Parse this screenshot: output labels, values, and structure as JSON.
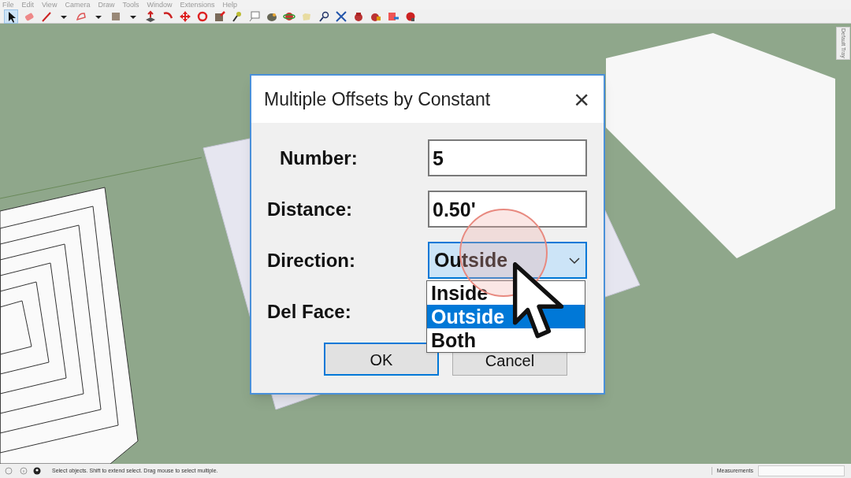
{
  "menu": [
    "File",
    "Edit",
    "View",
    "Camera",
    "Draw",
    "Tools",
    "Window",
    "Extensions",
    "Help"
  ],
  "tray_tab": "Default Tray",
  "dialog": {
    "title": "Multiple Offsets by Constant",
    "close": "×",
    "fields": [
      {
        "label": "Number:",
        "kind": "text",
        "value": "5"
      },
      {
        "label": "Distance:",
        "kind": "text",
        "value": "0.50'"
      },
      {
        "label": "Direction:",
        "kind": "dropdown",
        "value": "Outside",
        "expanded": true,
        "options": [
          {
            "label": "Inside",
            "selected": false
          },
          {
            "label": "Outside",
            "selected": true
          },
          {
            "label": "Both",
            "selected": false
          }
        ]
      },
      {
        "label": "Del Face:",
        "kind": "covered"
      }
    ],
    "buttons": [
      {
        "label": "OK",
        "focused": true
      },
      {
        "label": "Cancel",
        "focused": false
      }
    ]
  },
  "status_bar": {
    "message": "Select objects. Shift to extend select. Drag mouse to select multiple.",
    "measurements_label": "Measurements"
  }
}
